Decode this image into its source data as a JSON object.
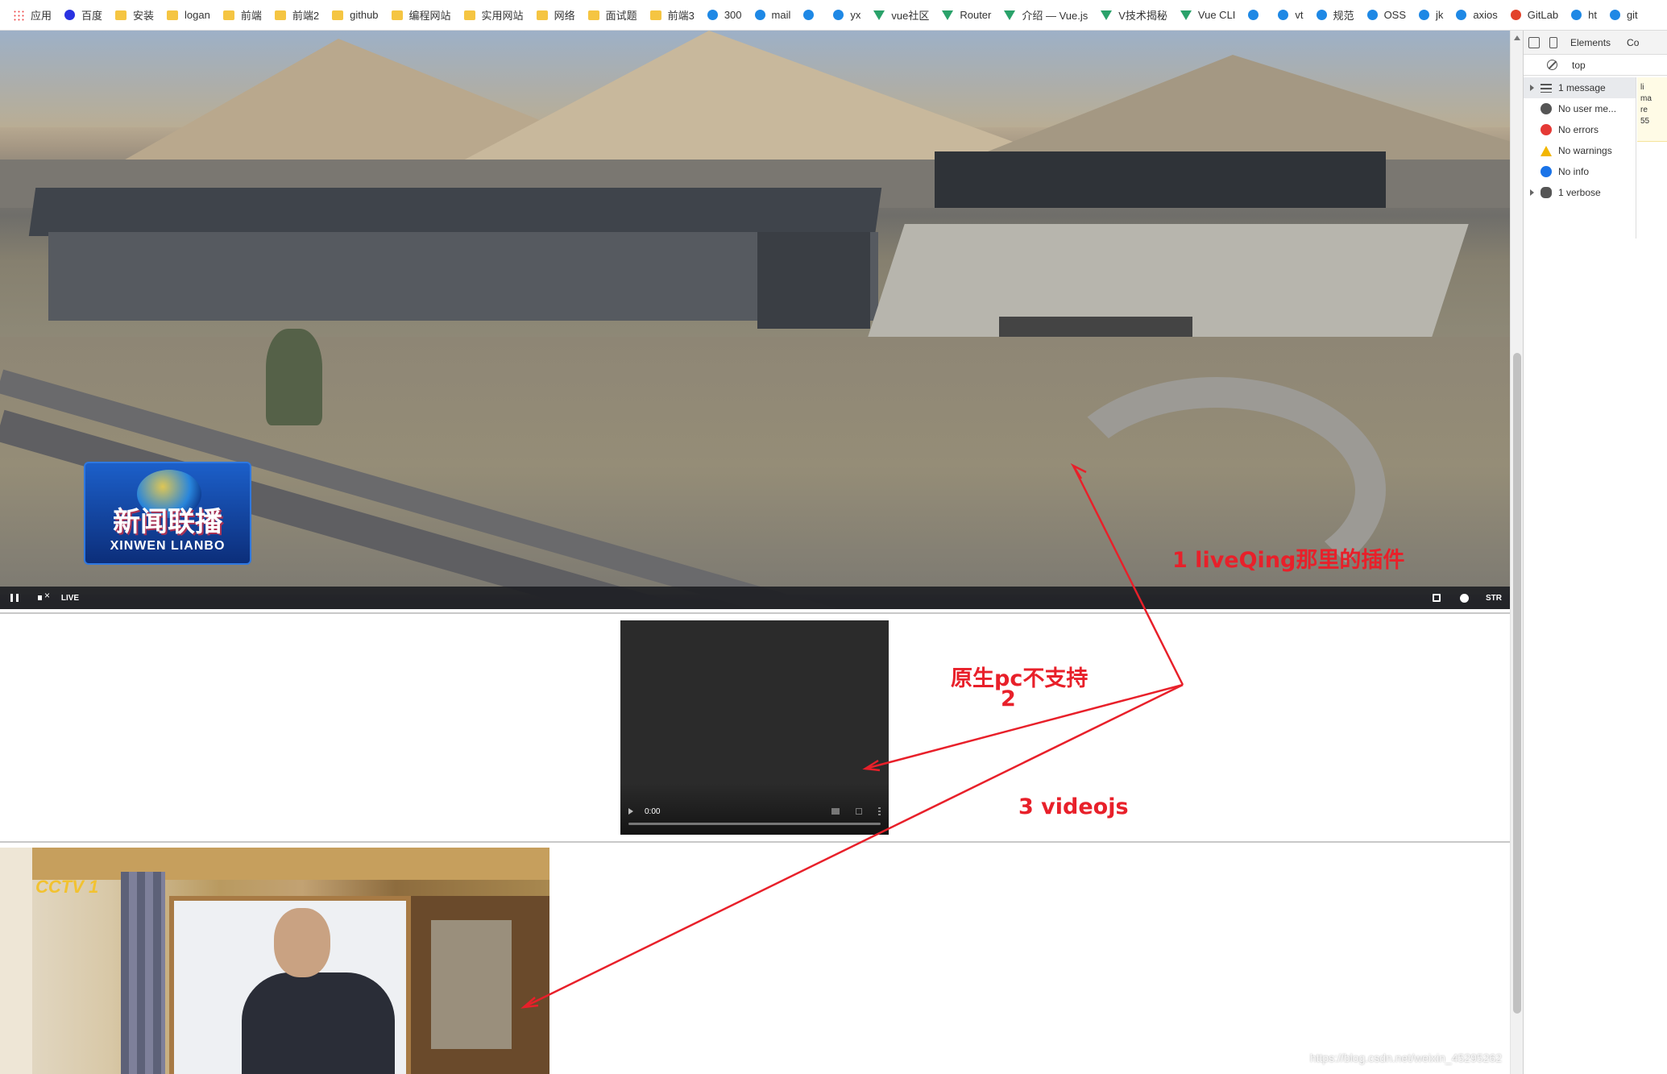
{
  "bookmarks": [
    {
      "label": "应用",
      "icon": "apps-grid-icon"
    },
    {
      "label": "百度",
      "icon": "baidu-icon"
    },
    {
      "label": "安装",
      "icon": "folder-icon"
    },
    {
      "label": "logan",
      "icon": "folder-icon"
    },
    {
      "label": "前端",
      "icon": "folder-icon"
    },
    {
      "label": "前端2",
      "icon": "folder-icon"
    },
    {
      "label": "github",
      "icon": "folder-icon"
    },
    {
      "label": "编程网站",
      "icon": "folder-icon"
    },
    {
      "label": "实用网站",
      "icon": "folder-icon"
    },
    {
      "label": "网络",
      "icon": "folder-icon"
    },
    {
      "label": "面试题",
      "icon": "folder-icon"
    },
    {
      "label": "前端3",
      "icon": "folder-icon"
    },
    {
      "label": "300",
      "icon": "site-icon"
    },
    {
      "label": "mail",
      "icon": "site-icon"
    },
    {
      "label": "",
      "icon": "site-icon"
    },
    {
      "label": "yx",
      "icon": "site-icon"
    },
    {
      "label": "vue社区",
      "icon": "vue-icon"
    },
    {
      "label": "Router",
      "icon": "vue-icon"
    },
    {
      "label": "介绍 — Vue.js",
      "icon": "vue-icon"
    },
    {
      "label": "V技术揭秘",
      "icon": "vue-icon"
    },
    {
      "label": "Vue CLI",
      "icon": "vue-icon"
    },
    {
      "label": "",
      "icon": "site-icon"
    },
    {
      "label": "vt",
      "icon": "site-icon"
    },
    {
      "label": "规范",
      "icon": "site-icon"
    },
    {
      "label": "OSS",
      "icon": "site-icon"
    },
    {
      "label": "jk",
      "icon": "site-icon"
    },
    {
      "label": "axios",
      "icon": "site-icon"
    },
    {
      "label": "GitLab",
      "icon": "gitlab-icon"
    },
    {
      "label": "ht",
      "icon": "site-icon"
    },
    {
      "label": "git",
      "icon": "site-icon"
    }
  ],
  "player1": {
    "logo_cn": "新闻联播",
    "logo_en": "XINWEN LIANBO",
    "live_label": "LIVE",
    "str_label": "STR"
  },
  "player2": {
    "time": "0:00"
  },
  "player3": {
    "channel_logo": "CCTV 1"
  },
  "annotations": {
    "a1": "1  liveQing那里的插件",
    "a2_line1": "原生pc不支持",
    "a2_line2": "2",
    "a3": "3 videojs"
  },
  "watermark": "https://blog.csdn.net/weixin_45295262",
  "devtools": {
    "tabs": [
      "Elements",
      "Co"
    ],
    "context": "top",
    "sidebar": [
      {
        "label": "1 message",
        "icon": "list-icon",
        "expandable": true
      },
      {
        "label": "No user me...",
        "icon": "user-icon",
        "expandable": false
      },
      {
        "label": "No errors",
        "icon": "error-icon",
        "expandable": false
      },
      {
        "label": "No warnings",
        "icon": "warning-icon",
        "expandable": false
      },
      {
        "label": "No info",
        "icon": "info-icon",
        "expandable": false
      },
      {
        "label": "1 verbose",
        "icon": "bug-icon",
        "expandable": true
      }
    ],
    "log_lines": [
      "li",
      "ma",
      "re",
      "55"
    ]
  },
  "colors": {
    "annotation": "#e8202a",
    "devtools_error": "#e53935",
    "devtools_warning": "#f2b600",
    "devtools_info": "#1a73e8"
  }
}
